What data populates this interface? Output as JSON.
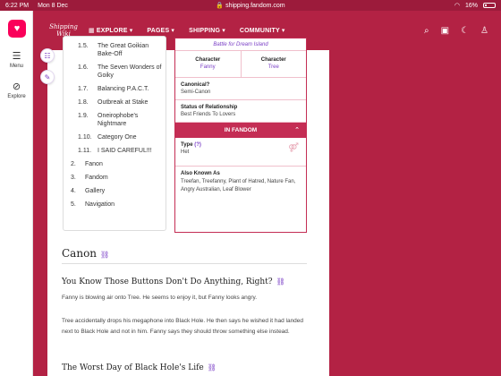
{
  "status_bar": {
    "time": "6:22 PM",
    "date": "Mon 8 Dec",
    "url": "shipping.fandom.com",
    "battery": "16%"
  },
  "rail": {
    "menu_label": "Menu",
    "explore_label": "Explore"
  },
  "nav": {
    "brand_line1": "Shipping",
    "brand_line2": "Wiki",
    "items": [
      "EXPLORE",
      "PAGES",
      "SHIPPING",
      "COMMUNITY"
    ]
  },
  "toc": [
    {
      "num": "1.5.",
      "text": "The Great Goikian Bake-Off"
    },
    {
      "num": "1.6.",
      "text": "The Seven Wonders of Goiky"
    },
    {
      "num": "1.7.",
      "text": "Balancing P.A.C.T."
    },
    {
      "num": "1.8.",
      "text": "Outbreak at Stake"
    },
    {
      "num": "1.9.",
      "text": "Oneirophobe's Nightmare"
    },
    {
      "num": "1.10.",
      "text": "Category One"
    },
    {
      "num": "1.11.",
      "text": "I SAID CAREFUL!!!"
    },
    {
      "num": "2.",
      "text": "Fanon"
    },
    {
      "num": "3.",
      "text": "Fandom"
    },
    {
      "num": "4.",
      "text": "Gallery"
    },
    {
      "num": "5.",
      "text": "Navigation"
    }
  ],
  "infobox": {
    "caption": "Battle for Dream Island",
    "char1_label": "Character",
    "char1_value": "Fanny",
    "char2_label": "Character",
    "char2_value": "Tree",
    "canonical_label": "Canonical?",
    "canonical_value": "Semi-Canon",
    "status_label": "Status of Relationship",
    "status_value": "Best Friends To Lovers",
    "fandom_header": "IN FANDOM",
    "type_label": "Type",
    "type_help": "(?)",
    "type_value": "Het",
    "aka_label": "Also Known As",
    "aka_value": "Treefan, Treefanny, Plant of Hatred, Nature Fan, Angry Australian, Leaf Blower"
  },
  "article": {
    "section_title": "Canon",
    "sub1": "You Know Those Buttons Don't Do Anything, Right?",
    "p1": "Fanny is blowing air onto Tree. He seems to enjoy it, but Fanny looks angry.",
    "p2": "Tree accidentally drops his megaphone into Black Hole. He then says he wished it had landed next to Black Hole and not in him. Fanny says they should throw something else instead.",
    "sub2": "The Worst Day of Black Hole's Life"
  }
}
